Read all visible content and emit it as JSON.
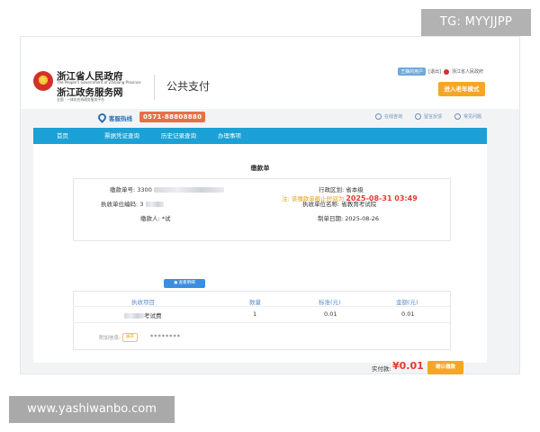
{
  "watermarks": {
    "tg": "TG: MYYJJPP",
    "site": "www.yashiwanbo.com"
  },
  "header": {
    "gov_name": "浙江省人民政府",
    "gov_en": "The People's Government of Zhejiang Province",
    "service_name": "浙江政务服务网",
    "service_sub": "全国 · 一体化在线政务服务平台",
    "page_title": "公共支付",
    "top_user": "王静的用户",
    "top_logout": "[退出]",
    "top_gov": "浙江省人民政府",
    "elder_mode": "进入老年模式"
  },
  "hotline": {
    "label": "客服热线",
    "number": "0571-88808880"
  },
  "quick_links": [
    {
      "label": "在线咨询",
      "icon": "chat-icon"
    },
    {
      "label": "留言反馈",
      "icon": "message-icon"
    },
    {
      "label": "常见问题",
      "icon": "question-icon"
    }
  ],
  "nav": {
    "items": [
      "首页",
      "票据凭证查询",
      "历史记录查询",
      "办理事项"
    ]
  },
  "form": {
    "title": "缴款单",
    "fields": {
      "bill_no_label": "缴款单号:",
      "bill_no_value": "3300",
      "region_label": "行政区划:",
      "region_value": "省本级",
      "unit_code_label": "执收单位编码:",
      "unit_code_value": "3",
      "unit_name_label": "执收单位名称:",
      "unit_name_value": "省教育考试院",
      "payer_label": "缴款人:",
      "payer_value": "*试",
      "date_label": "制单日期:",
      "date_value": "2025-08-26"
    },
    "deadline_text": "注: 该缴款单截止时间为",
    "deadline_value": "2025-08-31 03:49",
    "detail_button": "查看明细",
    "table": {
      "headers": [
        "执收项目",
        "数量",
        "标准(元)",
        "金额(元)"
      ],
      "rows": [
        {
          "item": "考试费",
          "qty": "1",
          "standard": "0.01",
          "amount": "0.01"
        }
      ]
    },
    "extra_label": "附加信息:",
    "extra_chip": "展开",
    "extra_value": "********"
  },
  "payment": {
    "label": "实付款:",
    "amount": "¥0.01",
    "confirm": "确认缴款"
  }
}
